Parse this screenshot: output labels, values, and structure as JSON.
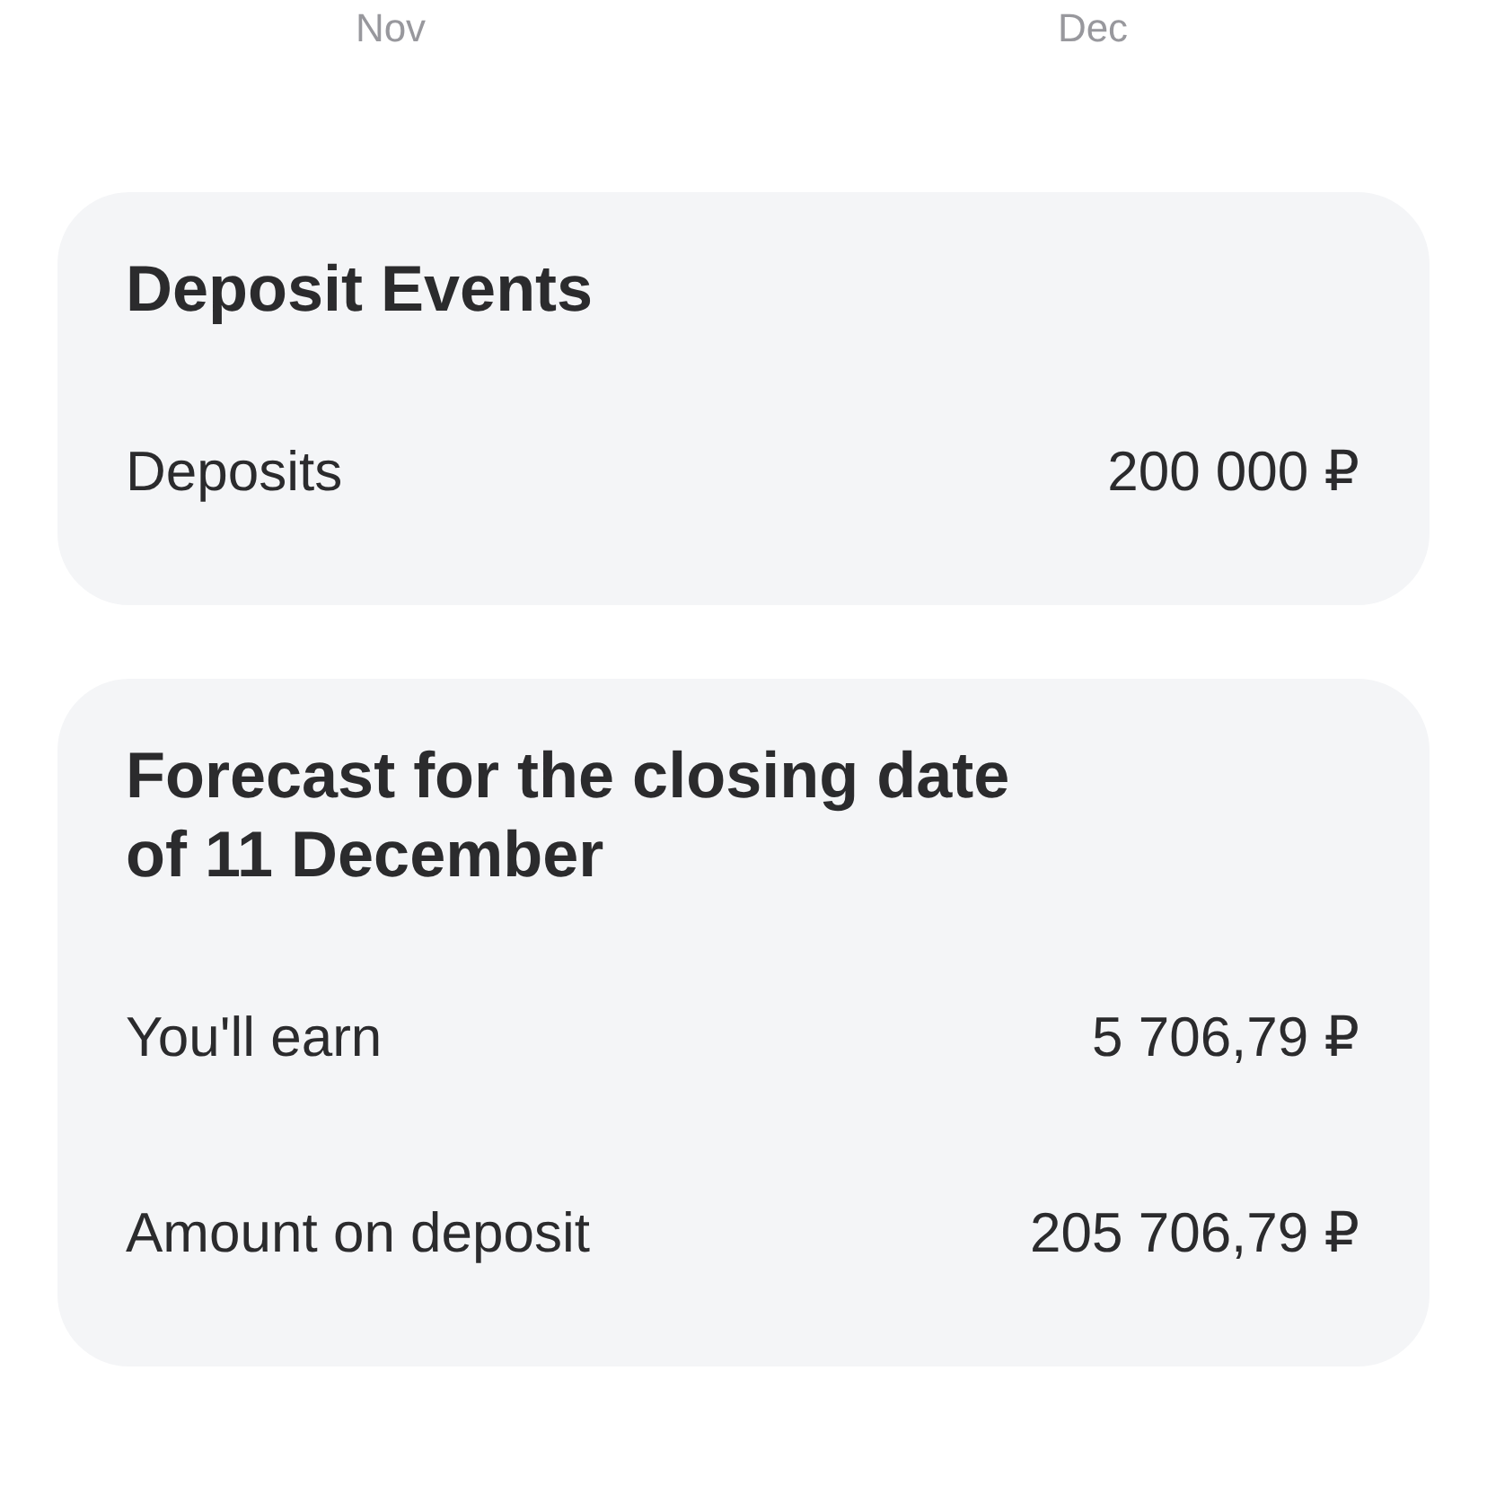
{
  "months": [
    "Nov",
    "Dec"
  ],
  "cards": [
    {
      "title": "Deposit Events",
      "rows": [
        {
          "label": "Deposits",
          "value": "200 000 ₽"
        }
      ]
    },
    {
      "title": "Forecast for the closing date of 11 December",
      "rows": [
        {
          "label": "You'll earn",
          "value": "5 706,79 ₽"
        },
        {
          "label": "Amount on deposit",
          "value": "205 706,79 ₽"
        }
      ]
    }
  ]
}
